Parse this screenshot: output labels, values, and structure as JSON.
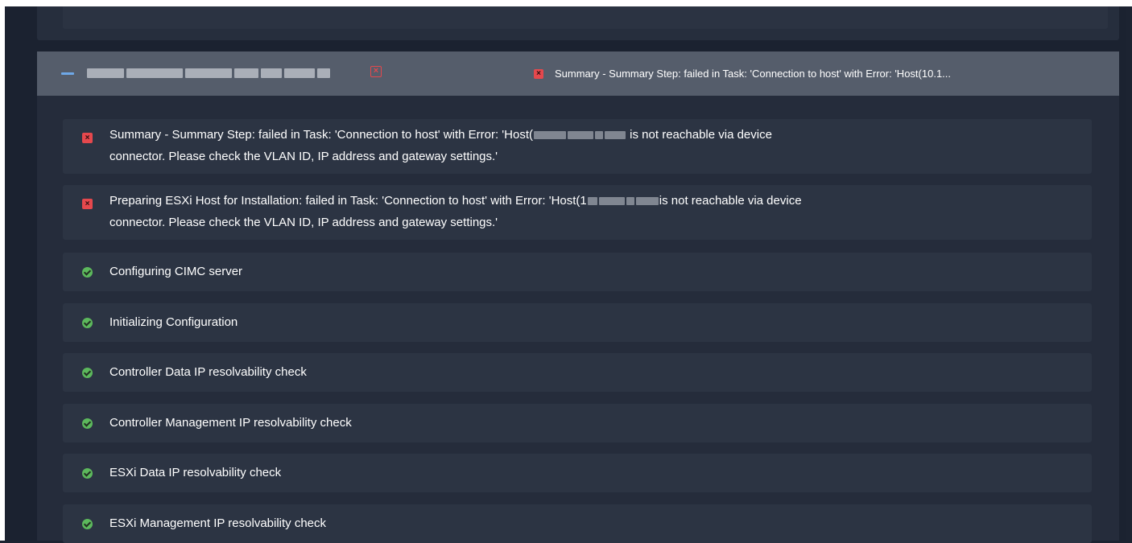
{
  "group": {
    "header_error_summary": "Summary - Summary Step: failed in Task: 'Connection to host' with Error: 'Host(10.1..."
  },
  "steps": [
    {
      "status": "failed",
      "text_before_host": "Summary - Summary Step: failed in Task: 'Connection to host' with Error: 'Host(",
      "text_after_host": " is not reachable via device",
      "text_line2": "connector. Please check the VLAN ID, IP address and gateway settings.'"
    },
    {
      "status": "failed",
      "text_before_host": "Preparing ESXi Host for Installation: failed in Task: 'Connection to host' with Error: 'Host(1",
      "text_after_host": "is not reachable via device",
      "text_line2": "connector. Please check the VLAN ID, IP address and gateway settings.'"
    },
    {
      "status": "success",
      "label": "Configuring CIMC server"
    },
    {
      "status": "success",
      "label": "Initializing Configuration"
    },
    {
      "status": "success",
      "label": "Controller Data IP resolvability check"
    },
    {
      "status": "success",
      "label": "Controller Management IP resolvability check"
    },
    {
      "status": "success",
      "label": "ESXi Data IP resolvability check"
    },
    {
      "status": "success",
      "label": "ESXi Management IP resolvability check"
    }
  ],
  "icons": {
    "collapse": "minus-icon",
    "failed": "x-square-icon",
    "success": "check-circle-icon"
  },
  "colors": {
    "background": "#1b2230",
    "header": "#555d6b",
    "row": "#2c3443",
    "error": "#e5484d",
    "success": "#5cb85c",
    "accent": "#6ea8e8"
  }
}
